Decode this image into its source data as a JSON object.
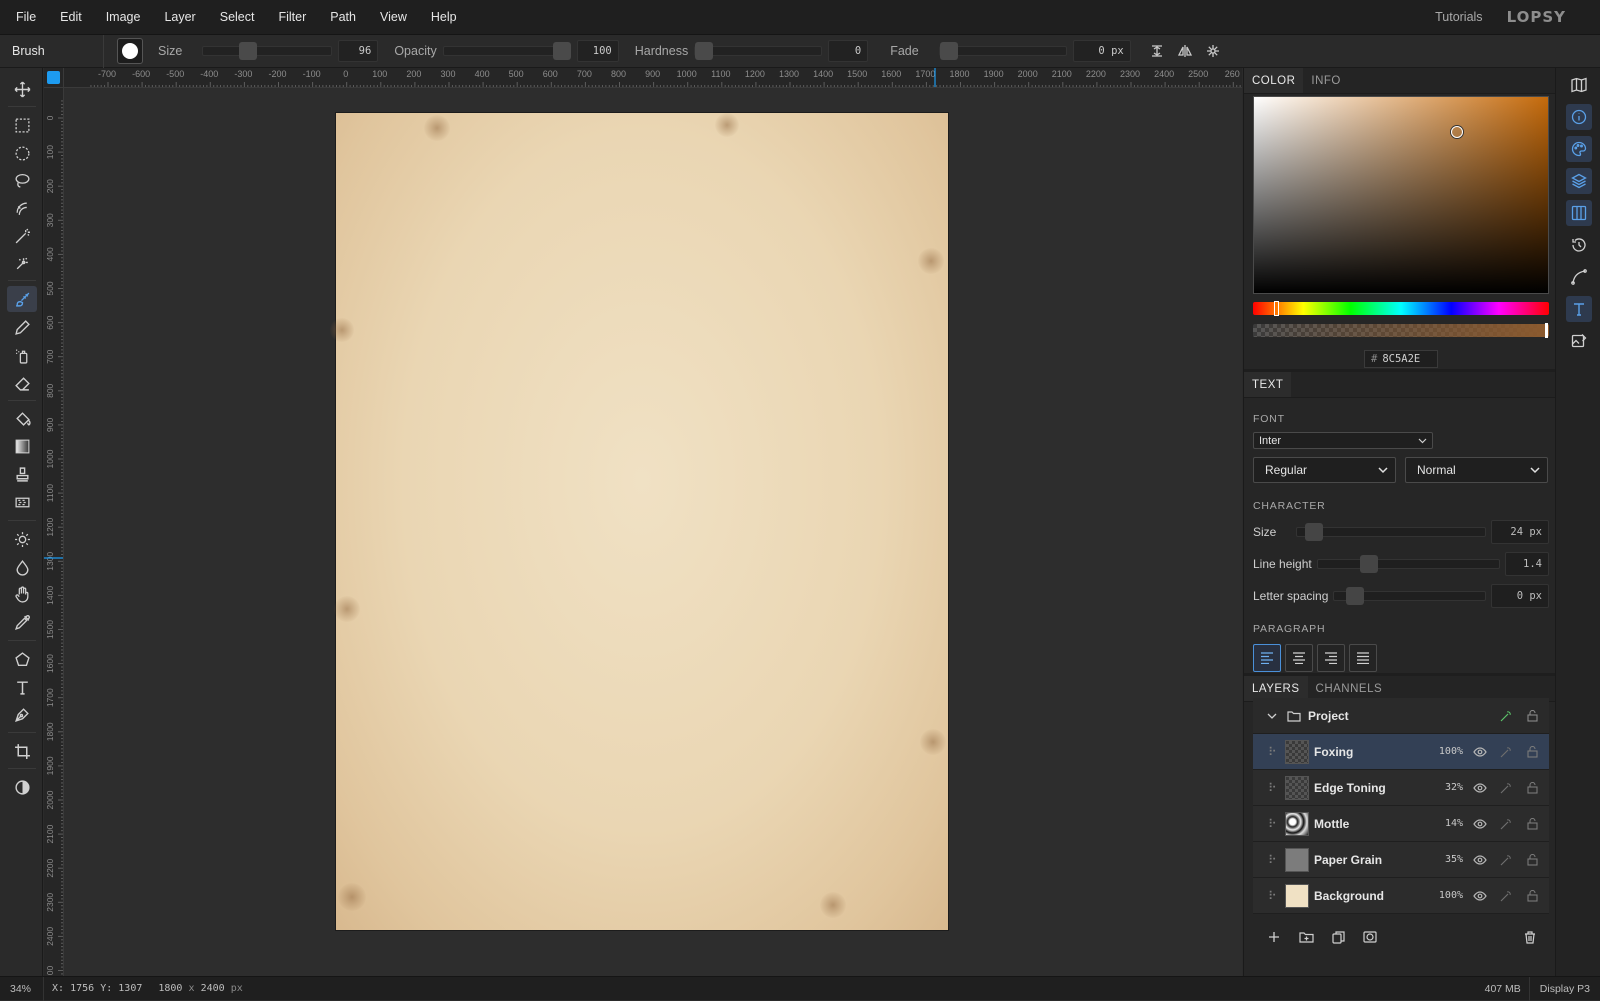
{
  "menubar": {
    "items": [
      "File",
      "Edit",
      "Image",
      "Layer",
      "Select",
      "Filter",
      "Path",
      "View",
      "Help"
    ],
    "tutorials": "Tutorials",
    "logo": "LOPSY"
  },
  "options": {
    "tool_name": "Brush",
    "size_label": "Size",
    "size_value": "96",
    "opacity_label": "Opacity",
    "opacity_value": "100",
    "hardness_label": "Hardness",
    "hardness_value": "0",
    "fade_label": "Fade",
    "fade_value": "0",
    "fade_unit": "px"
  },
  "toolbar": {
    "tools": [
      "move",
      "rect-select",
      "ellipse-select",
      "lasso",
      "quick-select",
      "magic-wand",
      "object-select",
      "brush",
      "pencil",
      "spray",
      "eraser",
      "fill",
      "gradient",
      "stamp",
      "pattern",
      "dodge",
      "blur",
      "smudge",
      "eyedropper",
      "polygon",
      "text",
      "pen",
      "crop",
      "contrast"
    ],
    "active_tool": "brush"
  },
  "rulers": {
    "top_labels": [
      "-700",
      "-600",
      "-500",
      "-400",
      "-300",
      "-200",
      "-100",
      "0",
      "100",
      "200",
      "300",
      "400",
      "500",
      "600",
      "700",
      "800",
      "900",
      "1000",
      "1100",
      "1200",
      "1300",
      "1400",
      "1500",
      "1600",
      "1700",
      "1800",
      "1900",
      "2000",
      "2100",
      "2200",
      "2300",
      "2400",
      "2500",
      "260"
    ],
    "left_labels": [
      "0",
      "100",
      "200",
      "300",
      "400",
      "500",
      "600",
      "700",
      "800",
      "900",
      "1000",
      "1100",
      "1200",
      "1300",
      "1400",
      "1500",
      "1600",
      "1700",
      "1800",
      "1900",
      "2000",
      "2100",
      "2200",
      "2300",
      "2400",
      "00"
    ]
  },
  "color_panel": {
    "tabs": [
      "COLOR",
      "INFO"
    ],
    "active_tab": "COLOR",
    "hex_label": "#",
    "hex_value": "8C5A2E",
    "accent_color": "#8C5A2E"
  },
  "text_panel": {
    "tab": "TEXT",
    "font_title": "FONT",
    "font_family": "Inter",
    "font_weight": "Regular",
    "font_style": "Normal",
    "character_title": "CHARACTER",
    "size_label": "Size",
    "size_value": "24 px",
    "line_height_label": "Line height",
    "line_height_value": "1.4",
    "letter_spacing_label": "Letter spacing",
    "letter_spacing_value": "0 px",
    "paragraph_title": "PARAGRAPH",
    "alignment_active": "left"
  },
  "layers_panel": {
    "tabs": [
      "LAYERS",
      "CHANNELS"
    ],
    "active_tab": "LAYERS",
    "group_name": "Project",
    "layers": [
      {
        "name": "Foxing",
        "opacity": "100%",
        "selected": true
      },
      {
        "name": "Edge Toning",
        "opacity": "32%",
        "selected": false
      },
      {
        "name": "Mottle",
        "opacity": "14%",
        "selected": false
      },
      {
        "name": "Paper Grain",
        "opacity": "35%",
        "selected": false
      },
      {
        "name": "Background",
        "opacity": "100%",
        "selected": false
      }
    ]
  },
  "statusbar": {
    "zoom": "34%",
    "x_label": "X:",
    "x_value": "1756",
    "y_label": "Y:",
    "y_value": "1307",
    "doc_width": "1800",
    "doc_by": "x",
    "doc_height": "2400",
    "doc_unit": "px",
    "memory": "407 MB",
    "color_profile": "Display P3"
  }
}
